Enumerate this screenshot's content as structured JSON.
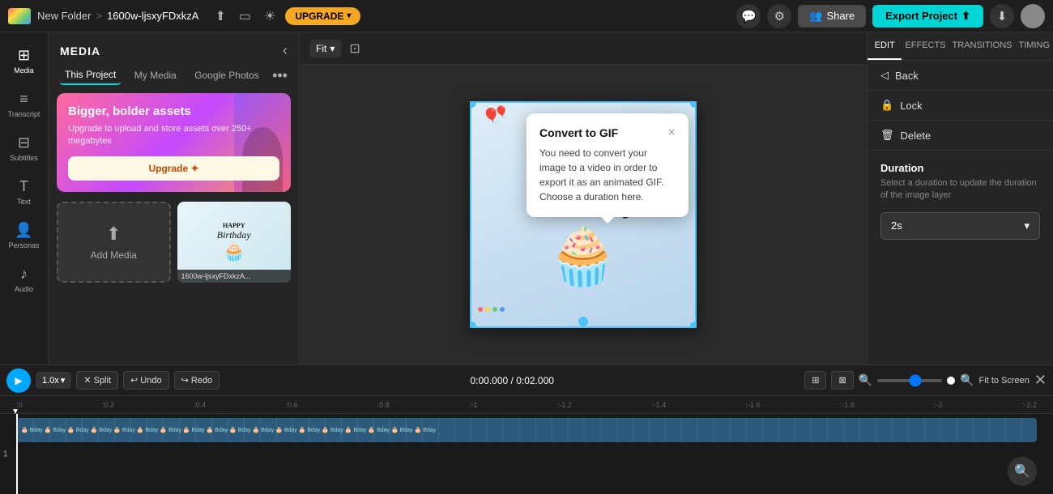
{
  "topbar": {
    "folder_label": "New Folder",
    "separator": ">",
    "project_name": "1600w-ljsxyFDxkzA",
    "upgrade_label": "UPGRADE",
    "share_label": "Share",
    "export_label": "Export Project"
  },
  "media_panel": {
    "title": "MEDIA",
    "tabs": [
      {
        "id": "this-project",
        "label": "This Project",
        "active": true
      },
      {
        "id": "my-media",
        "label": "My Media",
        "active": false
      },
      {
        "id": "google-photos",
        "label": "Google Photos",
        "active": false
      }
    ],
    "promo": {
      "title": "Bigger, bolder assets",
      "description": "Upgrade to upload and store assets over 250+ megabytes",
      "button_label": "Upgrade ✦"
    },
    "add_media_label": "Add Media",
    "thumbnail_label": "1600w-ljsxyFDxkzA..."
  },
  "canvas": {
    "fit_label": "Fit",
    "card_text_happy": "HAPPY",
    "card_text_birthday": "Birthday"
  },
  "convert_popup": {
    "title": "Convert to GIF",
    "text": "You need to convert your image to a video in order to export it as an animated GIF. Choose a duration here.",
    "close_label": "×"
  },
  "right_panel": {
    "tabs": [
      {
        "id": "edit",
        "label": "EDIT",
        "active": true
      },
      {
        "id": "effects",
        "label": "EFFECTS",
        "active": false
      },
      {
        "id": "transitions",
        "label": "TRANSITIONS",
        "active": false
      },
      {
        "id": "timing",
        "label": "TIMING",
        "active": false
      }
    ],
    "actions": [
      {
        "id": "back",
        "label": "Back",
        "icon": "◁"
      },
      {
        "id": "lock",
        "label": "Lock",
        "icon": "🔒"
      },
      {
        "id": "delete",
        "label": "Delete",
        "icon": "🗑"
      }
    ],
    "duration_section": {
      "title": "Duration",
      "description": "Select a duration to update the duration of the image layer",
      "selected": "2s"
    }
  },
  "timeline": {
    "speed_label": "1.0x",
    "split_label": "✕ Split",
    "undo_label": "↩ Undo",
    "redo_label": "↪ Redo",
    "time_current": "0:00.000",
    "time_total": "0:02.000",
    "fit_screen_label": "Fit to Screen",
    "ruler_marks": [
      ":0",
      ":0.2",
      ":0.4",
      ":0.6",
      ":0.8",
      ":-1",
      ":-1.2",
      ":-1.4",
      ":-1.6",
      ":-1.8",
      ":-2",
      ":-2.2"
    ]
  }
}
